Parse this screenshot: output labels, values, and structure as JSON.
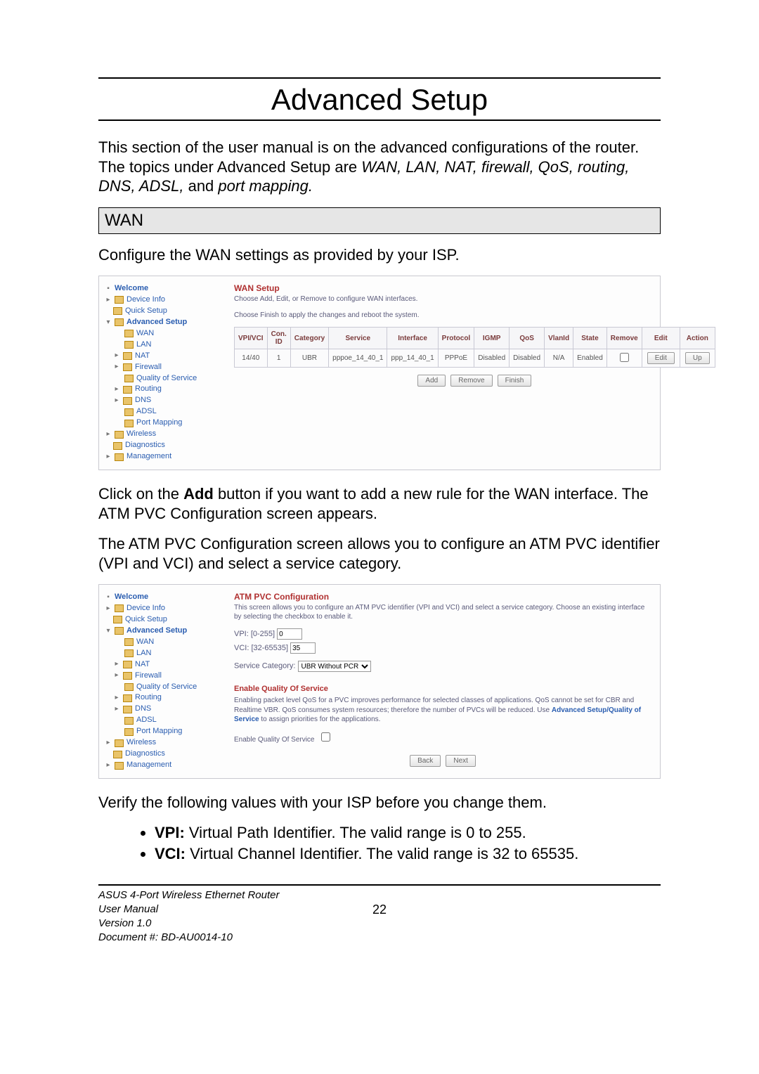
{
  "title": "Advanced Setup",
  "intro": {
    "pre": "This section of the user manual is on the advanced configurations of the router.  The topics under Advanced Setup are ",
    "topics": "WAN, LAN, NAT, firewall, QoS, routing, DNS, ADSL,",
    "mid": " and ",
    "last": "port mapping."
  },
  "wan_heading": "WAN",
  "wan_intro": "Configure the WAN settings as provided by your ISP.",
  "screenshot1": {
    "nav": {
      "welcome": "Welcome",
      "device_info": "Device Info",
      "quick_setup": "Quick Setup",
      "advanced_setup": "Advanced Setup",
      "wan": "WAN",
      "lan": "LAN",
      "nat": "NAT",
      "firewall": "Firewall",
      "qos": "Quality of Service",
      "routing": "Routing",
      "dns": "DNS",
      "adsl": "ADSL",
      "port_mapping": "Port Mapping",
      "wireless": "Wireless",
      "diagnostics": "Diagnostics",
      "management": "Management"
    },
    "panel": {
      "title": "WAN Setup",
      "sub1": "Choose Add, Edit, or Remove to configure WAN interfaces.",
      "sub2": "Choose Finish to apply the changes and reboot the system.",
      "headers": [
        "VPI/VCI",
        "Con. ID",
        "Category",
        "Service",
        "Interface",
        "Protocol",
        "IGMP",
        "QoS",
        "VlanId",
        "State",
        "Remove",
        "Edit",
        "Action"
      ],
      "row": {
        "vpivci": "14/40",
        "conid": "1",
        "category": "UBR",
        "service": "pppoe_14_40_1",
        "interface": "ppp_14_40_1",
        "protocol": "PPPoE",
        "igmp": "Disabled",
        "qos": "Disabled",
        "vlanid": "N/A",
        "state": "Enabled",
        "edit": "Edit",
        "action": "Up"
      },
      "buttons": {
        "add": "Add",
        "remove": "Remove",
        "finish": "Finish"
      }
    }
  },
  "para_add": {
    "p1a": "Click on the ",
    "p1b": "Add",
    "p1c": " button if you want to add a new rule for the WAN interface.  The ATM PVC Configuration screen appears.",
    "p2": "The ATM PVC Configuration screen allows you to configure an ATM PVC identifier (VPI and VCI) and select a service category."
  },
  "screenshot2": {
    "nav": {
      "welcome": "Welcome",
      "device_info": "Device Info",
      "quick_setup": "Quick Setup",
      "advanced_setup": "Advanced Setup",
      "wan": "WAN",
      "lan": "LAN",
      "nat": "NAT",
      "firewall": "Firewall",
      "qos": "Quality of Service",
      "routing": "Routing",
      "dns": "DNS",
      "adsl": "ADSL",
      "port_mapping": "Port Mapping",
      "wireless": "Wireless",
      "diagnostics": "Diagnostics",
      "management": "Management"
    },
    "panel": {
      "title": "ATM PVC Configuration",
      "sub": "This screen allows you to configure an ATM PVC identifier (VPI and VCI) and select a service category. Choose an existing interface by selecting the checkbox to enable it.",
      "vpi_label": "VPI: [0-255]",
      "vpi_value": "0",
      "vci_label": "VCI: [32-65535]",
      "vci_value": "35",
      "svc_label": "Service Category:",
      "svc_value": "UBR Without PCR",
      "qos_head": "Enable Quality Of Service",
      "qos_text_a": "Enabling packet level QoS for a PVC improves performance for selected classes of applications.  QoS cannot be set for CBR and Realtime VBR.  QoS consumes system resources; therefore the number of PVCs will be reduced. Use ",
      "qos_text_b": "Advanced Setup/Quality of Service",
      "qos_text_c": " to assign priorities for the applications.",
      "qos_chk_label": "Enable Quality Of Service",
      "buttons": {
        "back": "Back",
        "next": "Next"
      }
    }
  },
  "verify": "Verify the following values with your ISP before you change them.",
  "bullets": {
    "vpi_b": "VPI:",
    "vpi_t": " Virtual Path Identifier. The valid range is 0 to 255.",
    "vci_b": "VCI:",
    "vci_t": " Virtual Channel Identifier. The valid range is 32 to 65535."
  },
  "footer": {
    "l1": "ASUS 4-Port Wireless Ethernet Router",
    "l2": "User Manual",
    "l3": "Version 1.0",
    "l4": "Document #:  BD-AU0014-10",
    "page": "22"
  }
}
